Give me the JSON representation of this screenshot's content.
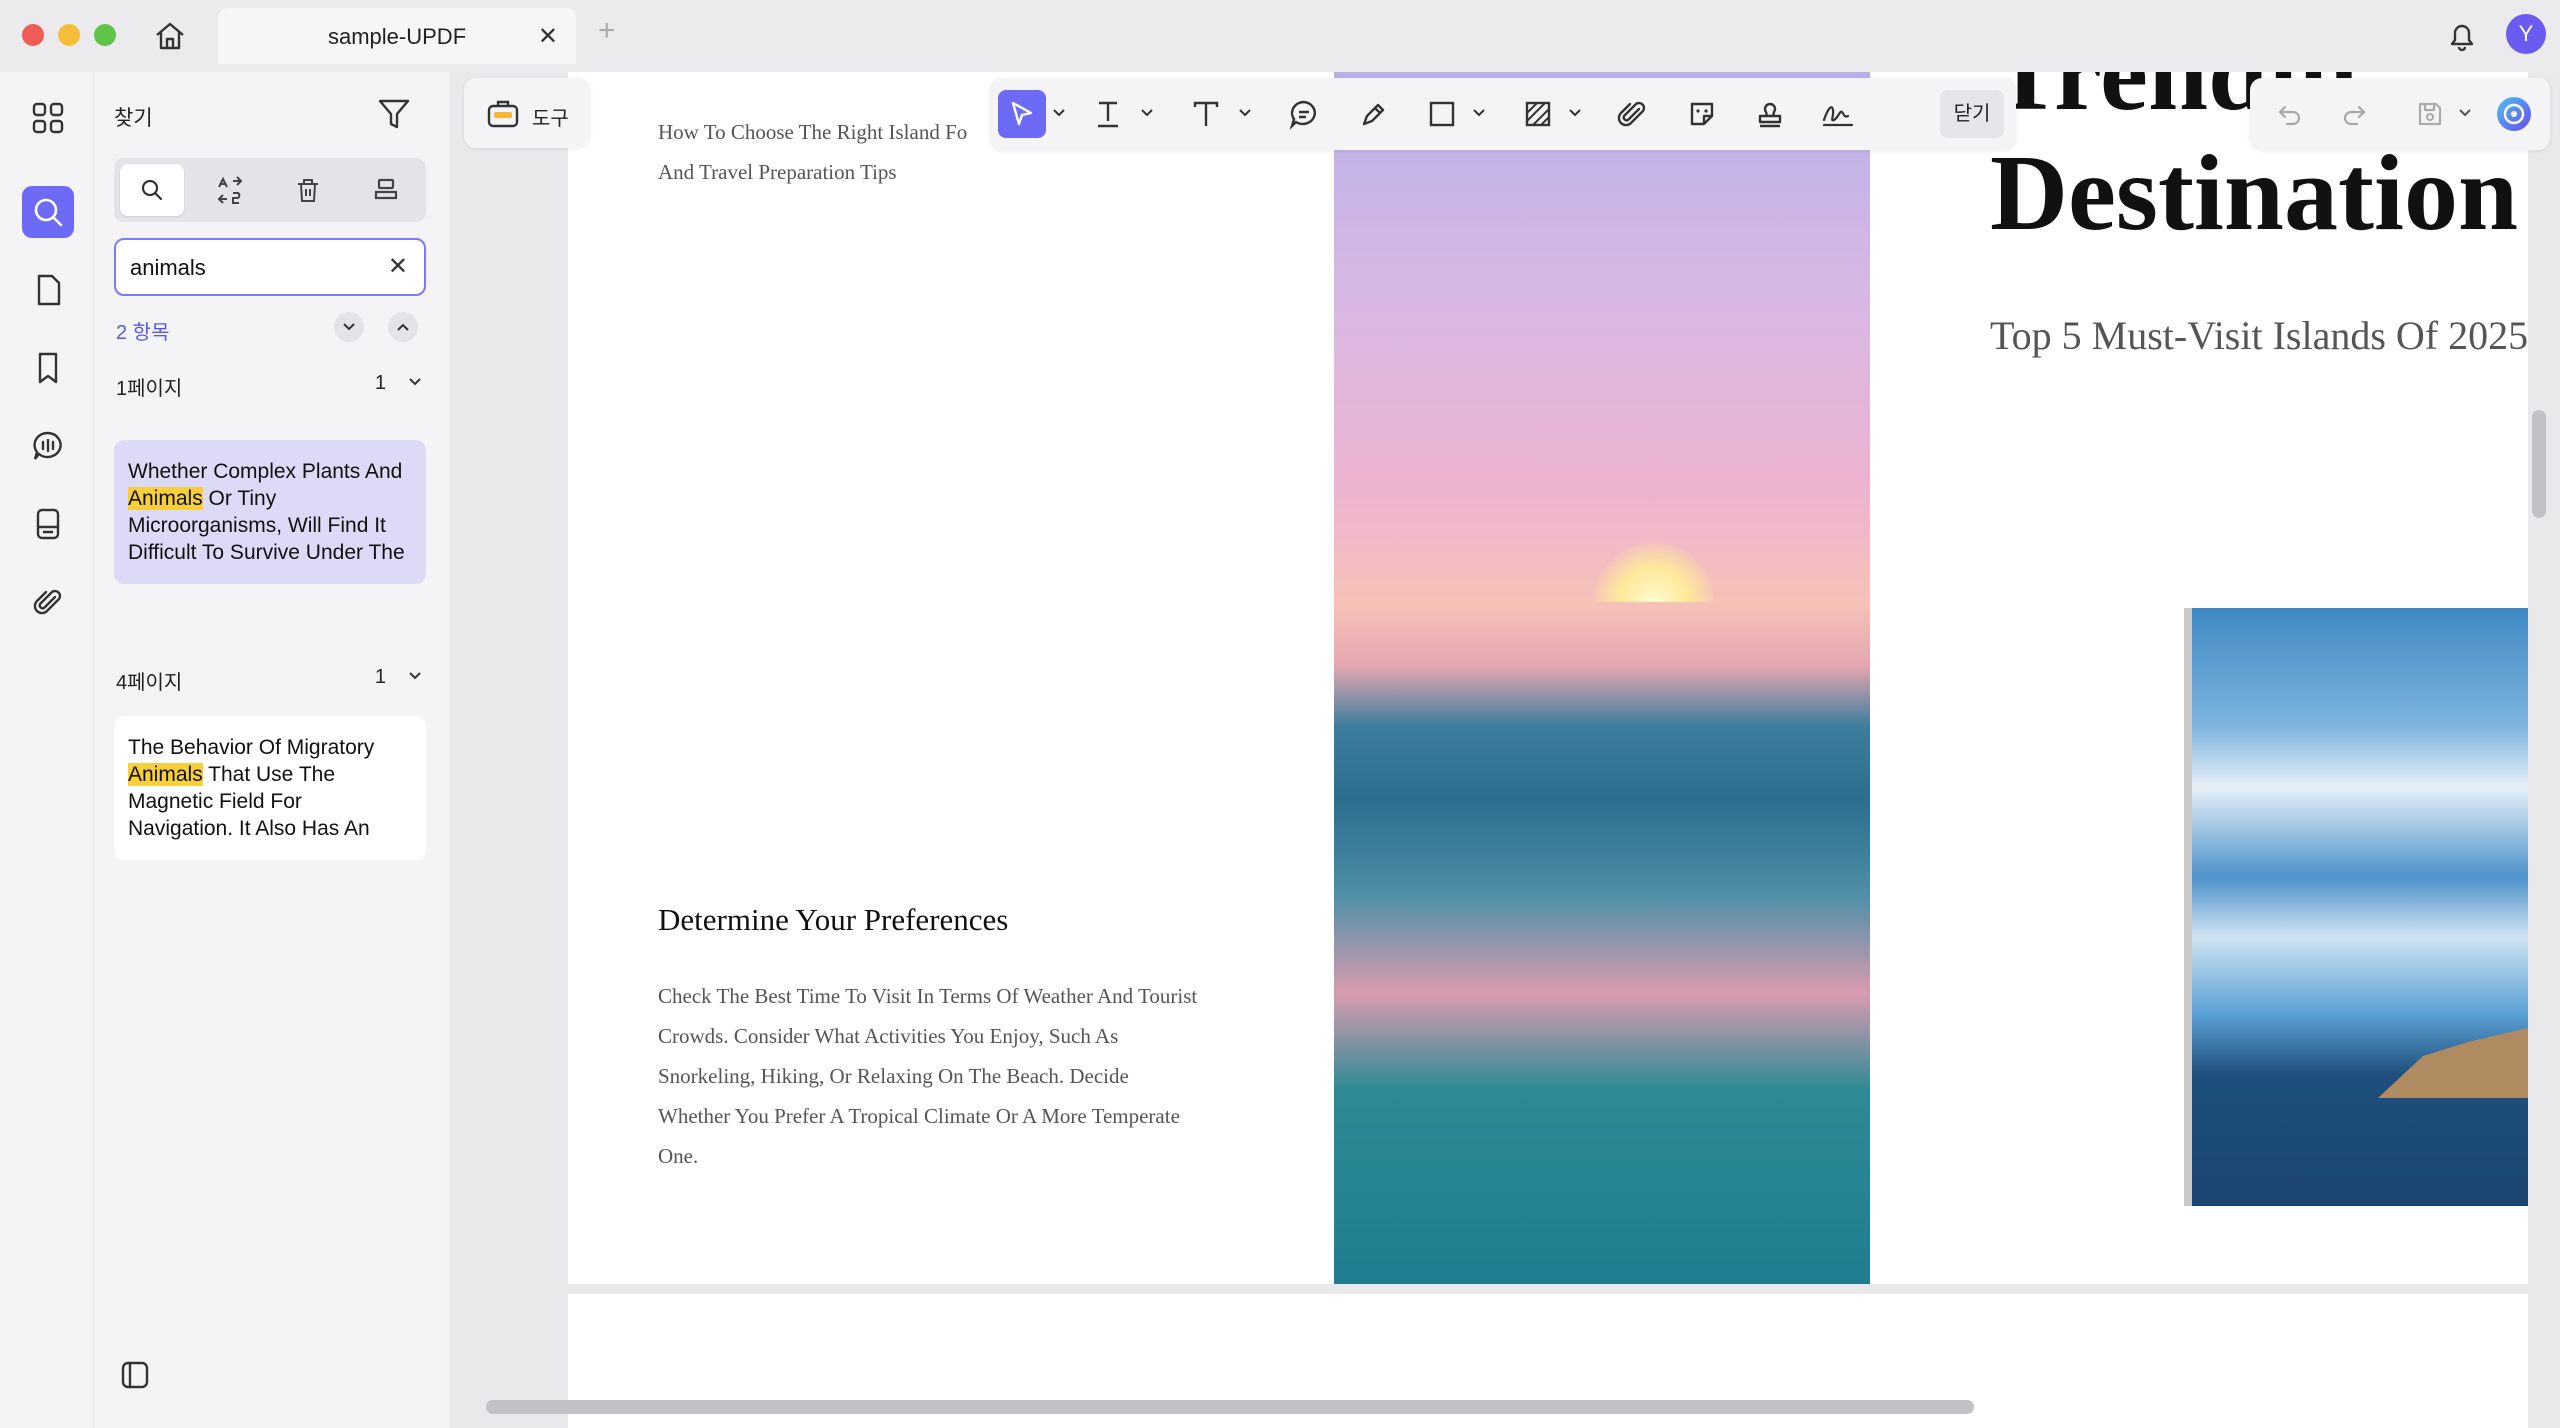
{
  "window": {
    "tab_title": "sample-UPDF",
    "tab_close": "✕",
    "tab_add": "+",
    "avatar_letter": "Y"
  },
  "search_panel": {
    "title": "찾기",
    "query": "animals",
    "result_count": "2 항목",
    "groups": [
      {
        "page_label": "1페이지",
        "count": "1",
        "snippet_before": "Whether Complex Plants And ",
        "snippet_match": "Animals",
        "snippet_after": " Or Tiny Microorganisms, Will Find It Difficult To Survive Under The"
      },
      {
        "page_label": "4페이지",
        "count": "1",
        "snippet_before": "The Behavior Of Migratory ",
        "snippet_match": "Animals",
        "snippet_after": " That Use The Magnetic Field For Navigation. It Also Has An"
      }
    ]
  },
  "toolbar": {
    "tools_label": "도구",
    "close_label": "닫기"
  },
  "document": {
    "subtitle": "How To Choose The Right Island Fo... And Travel Preparation Tips",
    "subtitle_line1": "How To Choose The Right Island Fo",
    "subtitle_line2": "And Travel Preparation Tips",
    "section_heading": "Determine Your Preferences",
    "section_body": "Check The Best Time To Visit In Terms Of Weather And Tourist Crowds. Consider What Activities You Enjoy, Such As Snorkeling, Hiking, Or Relaxing On The Beach. Decide Whether You Prefer A Tropical Climate Or A More Temperate One.",
    "big_title_top": "Trendin",
    "big_title": "Destination",
    "sub_title": "Top 5 Must-Visit Islands Of 2025"
  },
  "colors": {
    "accent": "#6d6af5",
    "highlight": "#f7cf3b",
    "selected_result": "#dcdaf6"
  }
}
